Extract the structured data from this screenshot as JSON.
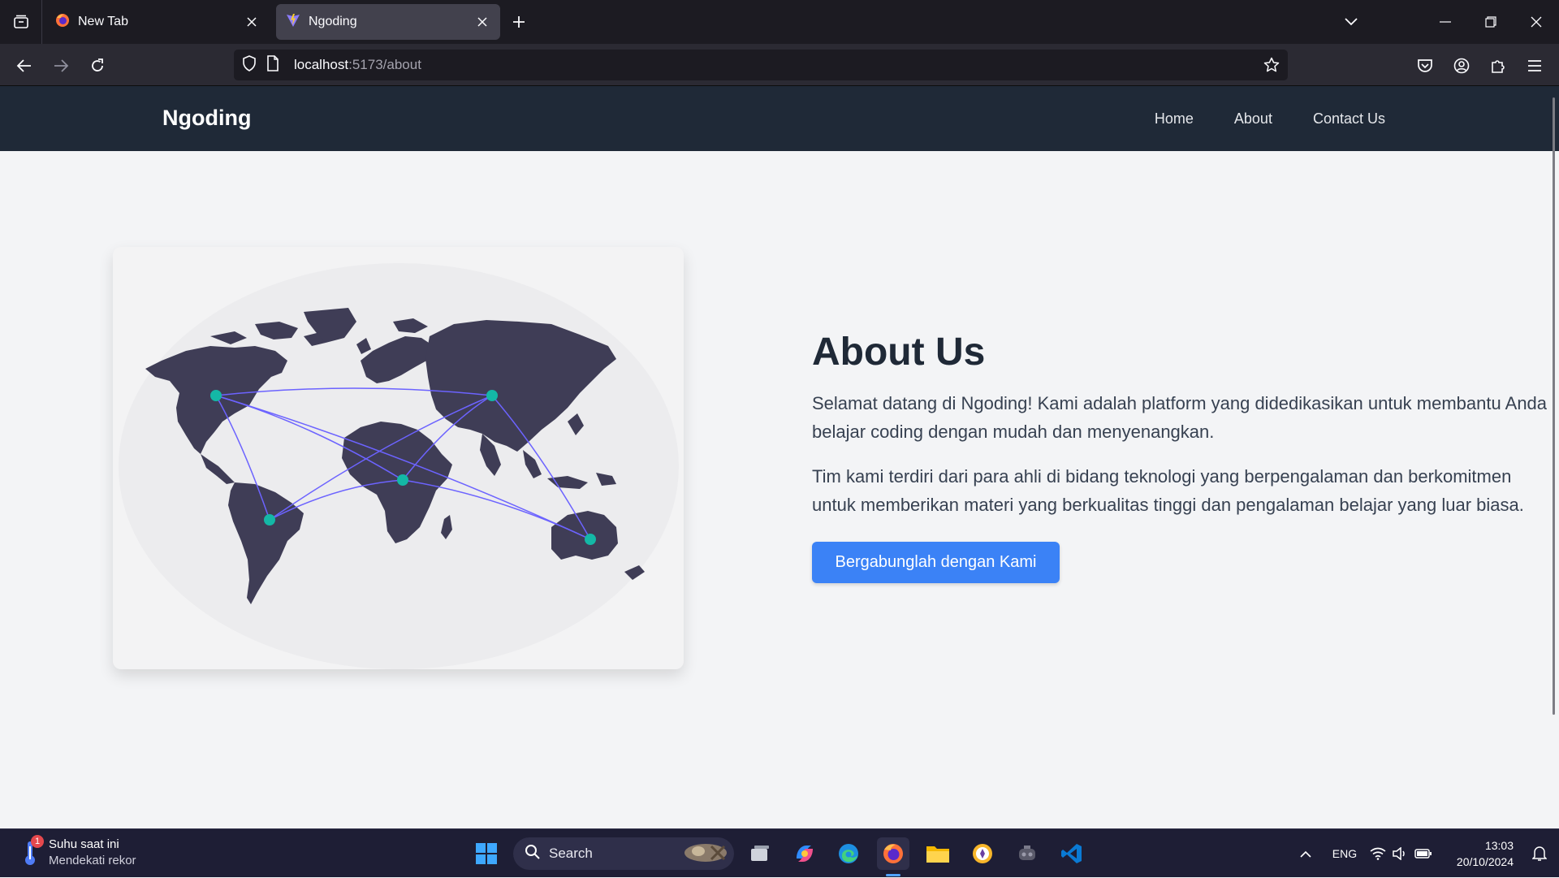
{
  "browser": {
    "tabs": [
      {
        "title": "New Tab",
        "active": false
      },
      {
        "title": "Ngoding",
        "active": true
      }
    ],
    "url": {
      "host": "localhost",
      "path": ":5173/about"
    }
  },
  "site": {
    "brand": "Ngoding",
    "nav": {
      "home": "Home",
      "about": "About",
      "contact": "Contact Us"
    }
  },
  "about": {
    "title": "About Us",
    "paragraph1": "Selamat datang di Ngoding! Kami adalah platform yang didedikasikan untuk membantu Anda belajar coding dengan mudah dan menyenangkan.",
    "paragraph2": "Tim kami terdiri dari para ahli di bidang teknologi yang berpengalaman dan berkomitmen untuk memberikan materi yang berkualitas tinggi dan pengalaman belajar yang luar biasa.",
    "button": "Bergabunglah dengan Kami"
  },
  "illustration": {
    "continent_color": "#3f3d56",
    "node_color": "#14b8a6",
    "line_color": "#6c63ff"
  },
  "taskbar": {
    "weather_title": "Suhu saat ini",
    "weather_sub": "Mendekati rekor",
    "weather_badge": "1",
    "search_placeholder": "Search",
    "language": "ENG",
    "time": "13:03",
    "date": "20/10/2024"
  },
  "colors": {
    "accent": "#3b82f6",
    "header": "#1f2937"
  }
}
